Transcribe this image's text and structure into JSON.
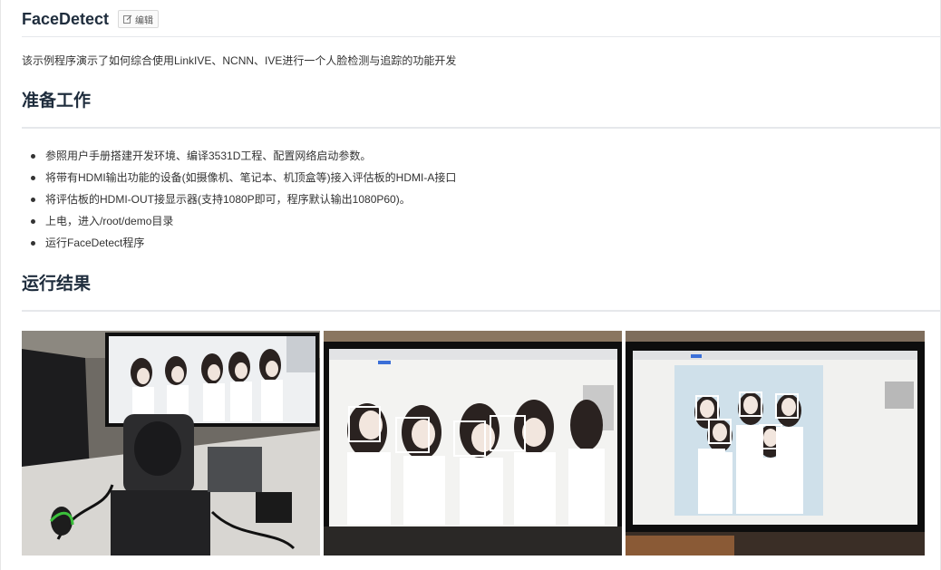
{
  "page_title": "FaceDetect",
  "edit_button": "编辑",
  "intro": "该示例程序演示了如何综合使用LinkIVE、NCNN、IVE进行一个人脸检测与追踪的功能开发",
  "section_prepare": {
    "heading": "准备工作",
    "steps": [
      "参照用户手册搭建开发环境、编译3531D工程、配置网络启动参数。",
      "将带有HDMI输出功能的设备(如摄像机、笔记本、机顶盒等)接入评估板的HDMI-A接口",
      "将评估板的HDMI-OUT接显示器(支持1080P即可，程序默认输出1080P60)。",
      "上电，进入/root/demo目录",
      "运行FaceDetect程序"
    ]
  },
  "section_result": {
    "heading": "运行结果"
  },
  "photos": [
    {
      "name": "camera-setup-photo"
    },
    {
      "name": "face-detection-result-photo-1"
    },
    {
      "name": "face-detection-result-photo-2"
    }
  ],
  "colors": {
    "heading": "#1f2d3d",
    "divider": "#e6e8eb",
    "detection_box": "#ffffff"
  }
}
